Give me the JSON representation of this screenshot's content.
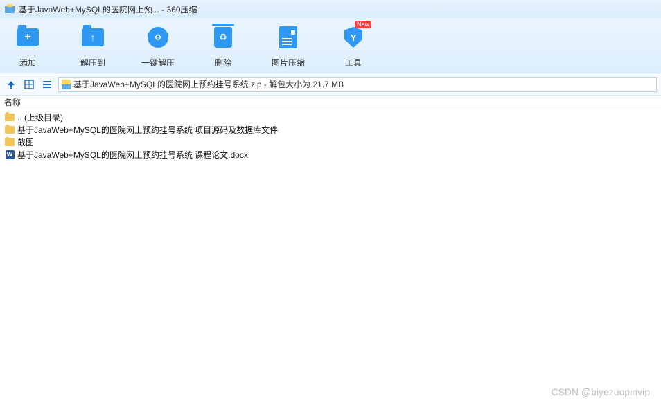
{
  "window": {
    "title": "基于JavaWeb+MySQL的医院网上预... - 360压缩"
  },
  "toolbar": {
    "add": "添加",
    "extract_to": "解压到",
    "one_click_extract": "一键解压",
    "delete": "删除",
    "image_compress": "图片压缩",
    "tools": "工具",
    "new_badge": "New"
  },
  "path": {
    "text": "基于JavaWeb+MySQL的医院网上预约挂号系统.zip - 解包大小为 21.7 MB"
  },
  "columns": {
    "name": "名称"
  },
  "files": [
    {
      "icon": "folder",
      "label": ".. (上级目录)"
    },
    {
      "icon": "folder",
      "label": "基于JavaWeb+MySQL的医院网上预约挂号系统 项目源码及数据库文件"
    },
    {
      "icon": "folder",
      "label": "截图"
    },
    {
      "icon": "word",
      "label": "基于JavaWeb+MySQL的医院网上预约挂号系统 课程论文.docx"
    }
  ],
  "watermark": "CSDN @biyezuopinvip"
}
